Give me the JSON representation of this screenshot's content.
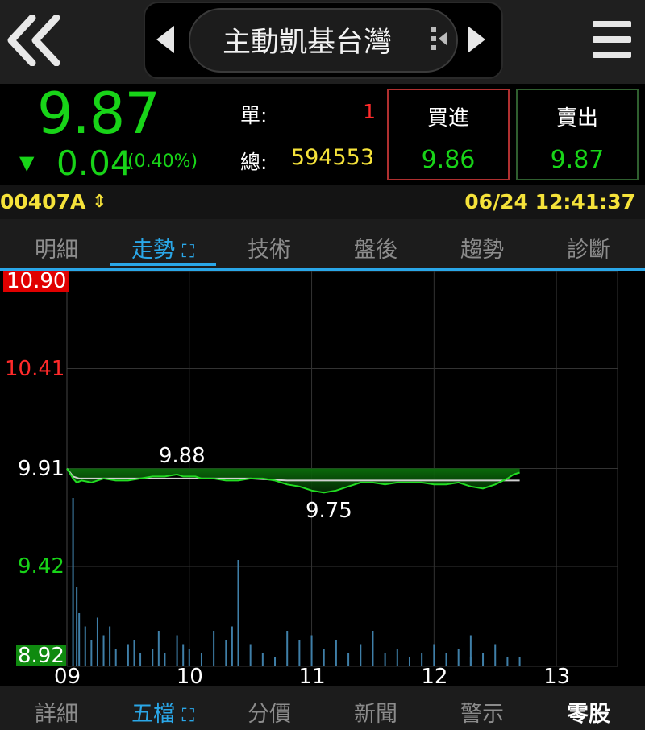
{
  "header": {
    "title": "主動凱基台灣",
    "back_icon": "double-chevron-left-icon",
    "prev_icon": "triangle-left-icon",
    "next_icon": "triangle-right-icon",
    "menu_icon": "hamburger-menu-icon"
  },
  "quote": {
    "price": "9.87",
    "change": "0.04",
    "change_percent": "(0.40%)",
    "direction": "down",
    "single_label": "單:",
    "single_volume": "1",
    "total_label": "總:",
    "total_volume": "594553",
    "buy_label": "買進",
    "buy_price": "9.86",
    "sell_label": "賣出",
    "sell_price": "9.87"
  },
  "info": {
    "code": "00407A",
    "datetime": "06/24 12:41:37"
  },
  "tabs": [
    {
      "label": "明細",
      "active": false
    },
    {
      "label": "走勢",
      "active": true
    },
    {
      "label": "技術",
      "active": false
    },
    {
      "label": "盤後",
      "active": false
    },
    {
      "label": "趨勢",
      "active": false
    },
    {
      "label": "診斷",
      "active": false
    }
  ],
  "bottom_tabs": [
    {
      "label": "詳細",
      "active": false
    },
    {
      "label": "五檔",
      "active": true
    },
    {
      "label": "分價",
      "active": false
    },
    {
      "label": "新聞",
      "active": false
    },
    {
      "label": "警示",
      "active": false
    },
    {
      "label": "零股",
      "active": false
    }
  ],
  "colors": {
    "up": "#ff2a2a",
    "down": "#18d418",
    "accent": "#2aa7e8",
    "highlight": "#f5e23a"
  },
  "chart_data": {
    "type": "line",
    "y_ticks": [
      "10.90",
      "10.41",
      "9.91",
      "9.42",
      "8.92"
    ],
    "x_ticks": [
      "09",
      "10",
      "11",
      "12",
      "13"
    ],
    "ylim": [
      8.92,
      10.9
    ],
    "reference": 9.91,
    "high_label": "9.88",
    "low_label": "9.75",
    "grid": true,
    "series": [
      {
        "role": "price",
        "x": [
          9.0,
          9.05,
          9.08,
          9.12,
          9.2,
          9.3,
          9.4,
          9.5,
          9.6,
          9.7,
          9.8,
          9.9,
          9.95,
          10.0,
          10.05,
          10.1,
          10.2,
          10.3,
          10.4,
          10.5,
          10.6,
          10.7,
          10.8,
          10.9,
          11.0,
          11.1,
          11.2,
          11.3,
          11.4,
          11.5,
          11.6,
          11.7,
          11.8,
          11.9,
          12.0,
          12.1,
          12.2,
          12.3,
          12.4,
          12.5,
          12.6,
          12.65,
          12.7
        ],
        "y": [
          9.91,
          9.86,
          9.84,
          9.85,
          9.84,
          9.86,
          9.85,
          9.85,
          9.86,
          9.87,
          9.87,
          9.88,
          9.87,
          9.87,
          9.87,
          9.86,
          9.86,
          9.85,
          9.85,
          9.86,
          9.86,
          9.85,
          9.83,
          9.82,
          9.8,
          9.79,
          9.8,
          9.82,
          9.84,
          9.84,
          9.83,
          9.84,
          9.84,
          9.84,
          9.83,
          9.83,
          9.84,
          9.82,
          9.81,
          9.83,
          9.86,
          9.88,
          9.89
        ]
      },
      {
        "role": "average",
        "x": [
          9.0,
          9.05,
          9.1,
          9.2,
          9.5,
          9.8,
          10.0,
          10.2,
          10.5,
          10.8,
          11.0,
          11.3,
          11.6,
          12.0,
          12.3,
          12.7
        ],
        "y": [
          9.91,
          9.87,
          9.86,
          9.86,
          9.86,
          9.86,
          9.86,
          9.86,
          9.86,
          9.85,
          9.85,
          9.85,
          9.85,
          9.85,
          9.85,
          9.85
        ]
      }
    ],
    "volume": {
      "x": [
        9.05,
        9.08,
        9.1,
        9.15,
        9.2,
        9.25,
        9.3,
        9.35,
        9.4,
        9.5,
        9.55,
        9.6,
        9.7,
        9.75,
        9.8,
        9.9,
        9.95,
        10.0,
        10.1,
        10.2,
        10.3,
        10.35,
        10.4,
        10.5,
        10.6,
        10.7,
        10.8,
        10.9,
        11.0,
        11.1,
        11.2,
        11.3,
        11.4,
        11.5,
        11.6,
        11.7,
        11.8,
        11.9,
        12.0,
        12.1,
        12.2,
        12.3,
        12.3,
        12.4,
        12.5,
        12.6,
        12.7
      ],
      "y": [
        380,
        180,
        120,
        90,
        60,
        110,
        70,
        90,
        40,
        50,
        60,
        30,
        40,
        80,
        30,
        70,
        50,
        40,
        30,
        80,
        60,
        90,
        240,
        50,
        30,
        20,
        80,
        60,
        70,
        40,
        60,
        30,
        50,
        80,
        30,
        40,
        20,
        30,
        50,
        30,
        40,
        20,
        70,
        30,
        50,
        20,
        20
      ]
    }
  }
}
